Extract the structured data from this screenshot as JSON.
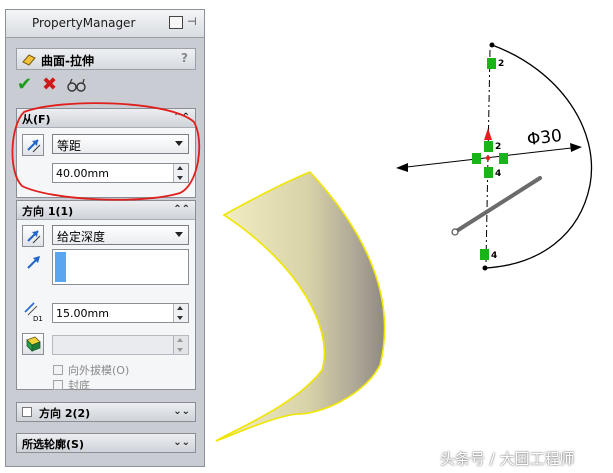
{
  "panel": {
    "title": "PropertyManager",
    "feature_name": "曲面-拉伸",
    "help": "?",
    "from_section": {
      "title": "从(F)",
      "condition": "等距",
      "offset_value": "40.00mm"
    },
    "direction1": {
      "title": "方向 1(1)",
      "end_condition": "给定深度",
      "depth": "15.00mm",
      "draft_outward_label": "向外拔模(O)",
      "cap_label": "封底"
    },
    "direction2": {
      "title": "方向 2(2)"
    },
    "selected_contours": {
      "title": "所选轮廓(S)"
    }
  },
  "canvas": {
    "dimension_label": "Φ30",
    "relation_labels": [
      "2",
      "2",
      "4",
      "4"
    ]
  },
  "watermark": "头条号 / 大国工程师",
  "colors": {
    "panel_bg": "#c9ccd2",
    "accept": "#1e9a1e",
    "cancel": "#d01818",
    "annotation_circle": "#e0201c",
    "surface_edge": "#f0e600",
    "relation_marker": "#18b418"
  }
}
